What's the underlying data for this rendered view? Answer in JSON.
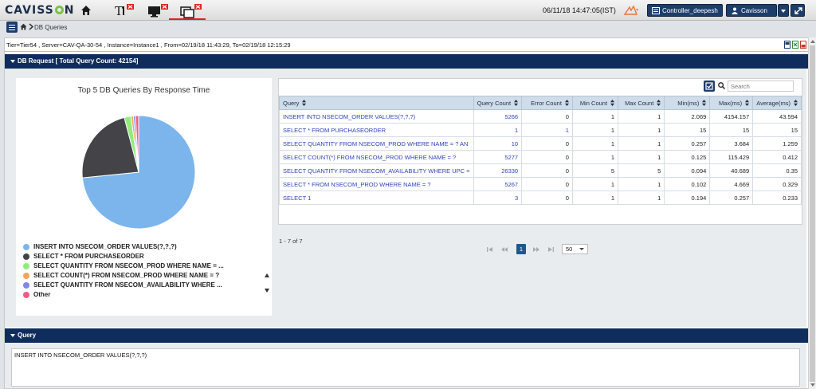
{
  "app": {
    "logo": "CAVISSON",
    "datetime": "06/11/18 14:47:05(IST)",
    "controller_label": "Controller_deepesh",
    "user_label": "Cavisson"
  },
  "breadcrumb": {
    "current": "DB Queries"
  },
  "filter": {
    "text": "Tier=Tier54 , Server=CAV-QA-30-54 , Instance=Instance1 , From=02/19/18 11:43:29, To=02/19/18 12:15:29"
  },
  "db_request_panel": {
    "title": "DB Request [ Total Query Count: 42154]"
  },
  "chart_data": {
    "type": "pie",
    "title": "Top 5 DB Queries By Response Time",
    "slices": [
      {
        "label": "INSERT INTO NSECOM_ORDER VALUES(?,?,?)",
        "value": 73.4,
        "color": "#7cb5ec"
      },
      {
        "label": "SELECT * FROM PURCHASEORDER",
        "value": 22.5,
        "color": "#434348"
      },
      {
        "label": "SELECT QUANTITY FROM NSECOM_PROD WHERE NAME = ...",
        "value": 1.9,
        "color": "#90ed7d"
      },
      {
        "label": "SELECT COUNT(*) FROM NSECOM_PROD WHERE NAME = ?",
        "value": 0.7,
        "color": "#f7a35c"
      },
      {
        "label": "SELECT QUANTITY FROM NSECOM_AVAILABILITY WHERE ...",
        "value": 0.6,
        "color": "#8085e9"
      },
      {
        "label": "Other",
        "value": 0.9,
        "color": "#f15c80"
      }
    ],
    "legend_position": "bottom"
  },
  "table": {
    "search_placeholder": "Search",
    "columns": [
      "Query",
      "Query Count",
      "Error Count",
      "Min Count",
      "Max Count",
      "Min(ms)",
      "Max(ms)",
      "Average(ms)"
    ],
    "rows": [
      [
        "INSERT INTO NSECOM_ORDER VALUES(?,?,?)",
        "5266",
        "0",
        "1",
        "1",
        "2.069",
        "4154.157",
        "43.594"
      ],
      [
        "SELECT * FROM PURCHASEORDER",
        "1",
        "1",
        "1",
        "1",
        "15",
        "15",
        "15"
      ],
      [
        "SELECT QUANTITY FROM NSECOM_PROD WHERE NAME = ? AN",
        "10",
        "0",
        "1",
        "1",
        "0.257",
        "3.684",
        "1.259"
      ],
      [
        "SELECT COUNT(*) FROM NSECOM_PROD WHERE NAME = ?",
        "5277",
        "0",
        "1",
        "1",
        "0.125",
        "115.429",
        "0.412"
      ],
      [
        "SELECT QUANTITY FROM NSECOM_AVAILABILITY WHERE UPC =",
        "26330",
        "0",
        "5",
        "5",
        "0.094",
        "40.689",
        "0.35"
      ],
      [
        "SELECT * FROM NSECOM_PROD WHERE NAME = ?",
        "5267",
        "0",
        "1",
        "1",
        "0.102",
        "4.669",
        "0.329"
      ],
      [
        "SELECT 1",
        "3",
        "0",
        "1",
        "1",
        "0.194",
        "0.257",
        "0.233"
      ]
    ],
    "row_count_text": "1 - 7 of 7",
    "current_page": "1",
    "page_size": "50"
  },
  "query_panel": {
    "title": "Query",
    "text": "INSERT INTO NSECOM_ORDER VALUES(?,?,?)"
  },
  "colors": {
    "header_navy": "#0f2d5c",
    "button_navy": "#1d3d6b",
    "link_blue": "#3044b8",
    "logo_green": "#7cc242",
    "alert_red": "#d22222"
  },
  "icons": [
    "home-icon",
    "text-tool-icon",
    "monitor-icon",
    "windows-icon",
    "alert-icon",
    "controller-icon",
    "user-icon",
    "expand-icon",
    "menu-icon",
    "pdf-icon",
    "excel-icon",
    "word-icon",
    "search-icon",
    "checkbox-icon"
  ]
}
